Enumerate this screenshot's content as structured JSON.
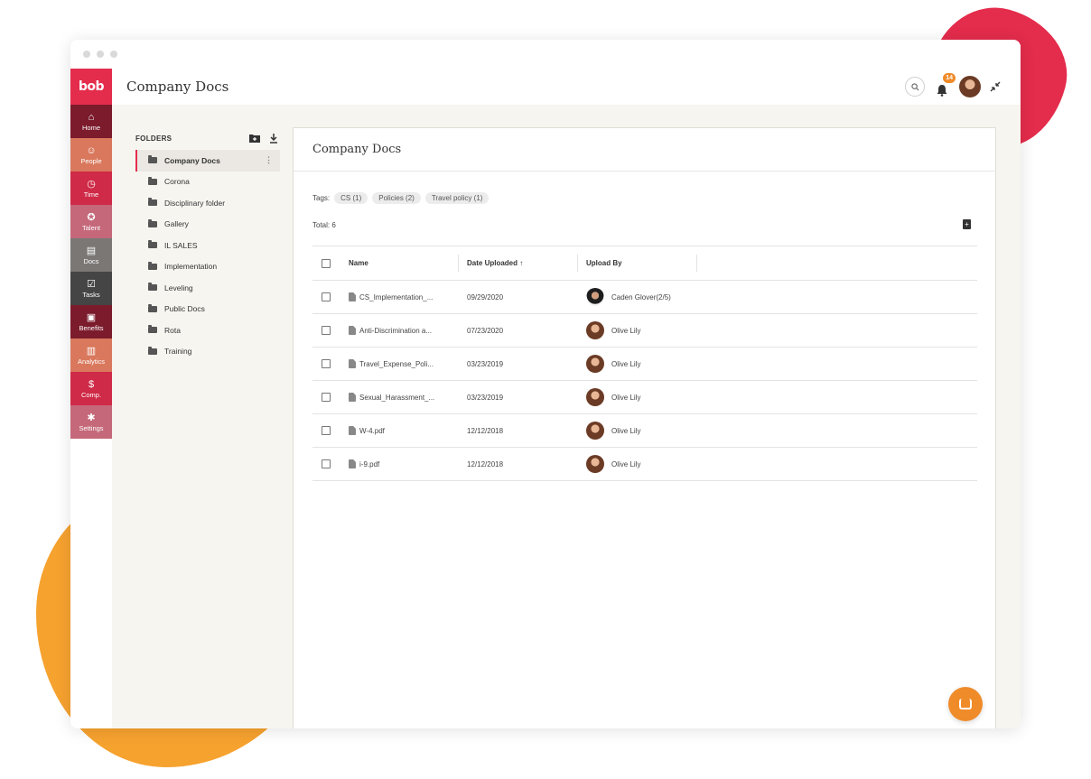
{
  "app": {
    "logo": "bob",
    "page_title": "Company Docs",
    "notification_count": "14"
  },
  "sidebar": {
    "items": [
      {
        "label": "Home",
        "icon": "home-icon",
        "glyph": "⌂",
        "color": "#7b1b2c"
      },
      {
        "label": "People",
        "icon": "people-icon",
        "glyph": "☺",
        "color": "#d9785c"
      },
      {
        "label": "Time",
        "icon": "clock-icon",
        "glyph": "◷",
        "color": "#cf2a47"
      },
      {
        "label": "Talent",
        "icon": "talent-icon",
        "glyph": "✪",
        "color": "#c4687a"
      },
      {
        "label": "Docs",
        "icon": "docs-icon",
        "glyph": "▤",
        "color": "#7a7775"
      },
      {
        "label": "Tasks",
        "icon": "tasks-icon",
        "glyph": "☑",
        "color": "#454545"
      },
      {
        "label": "Benefits",
        "icon": "gift-icon",
        "glyph": "▣",
        "color": "#7b1b2c"
      },
      {
        "label": "Analytics",
        "icon": "analytics-icon",
        "glyph": "▥",
        "color": "#d9785c"
      },
      {
        "label": "Comp.",
        "icon": "compensation-icon",
        "glyph": "$",
        "color": "#cf2a47"
      },
      {
        "label": "Settings",
        "icon": "gear-icon",
        "glyph": "✱",
        "color": "#c4687a"
      }
    ]
  },
  "folders": {
    "heading": "FOLDERS",
    "items": [
      {
        "label": "Company Docs",
        "active": true
      },
      {
        "label": "Corona"
      },
      {
        "label": "Disciplinary folder"
      },
      {
        "label": "Gallery"
      },
      {
        "label": "IL SALES"
      },
      {
        "label": "Implementation"
      },
      {
        "label": "Leveling"
      },
      {
        "label": "Public Docs"
      },
      {
        "label": "Rota"
      },
      {
        "label": "Training"
      }
    ]
  },
  "panel": {
    "title": "Company Docs",
    "tags_label": "Tags:",
    "tags": [
      "CS (1)",
      "Policies (2)",
      "Travel policy (1)"
    ],
    "total": "Total: 6"
  },
  "table": {
    "columns": {
      "name": "Name",
      "date": "Date Uploaded ↑",
      "by": "Upload By"
    },
    "rows": [
      {
        "name": "CS_Implementation_...",
        "date": "09/29/2020",
        "by": "Caden Glover(2/5)",
        "avatar": "man"
      },
      {
        "name": "Anti-Discrimination a...",
        "date": "07/23/2020",
        "by": "Olive Lily",
        "avatar": "woman"
      },
      {
        "name": "Travel_Expense_Poli...",
        "date": "03/23/2019",
        "by": "Olive Lily",
        "avatar": "woman"
      },
      {
        "name": "Sexual_Harassment_...",
        "date": "03/23/2019",
        "by": "Olive Lily",
        "avatar": "woman"
      },
      {
        "name": "W-4.pdf",
        "date": "12/12/2018",
        "by": "Olive Lily",
        "avatar": "woman"
      },
      {
        "name": "i-9.pdf",
        "date": "12/12/2018",
        "by": "Olive Lily",
        "avatar": "woman"
      }
    ]
  }
}
